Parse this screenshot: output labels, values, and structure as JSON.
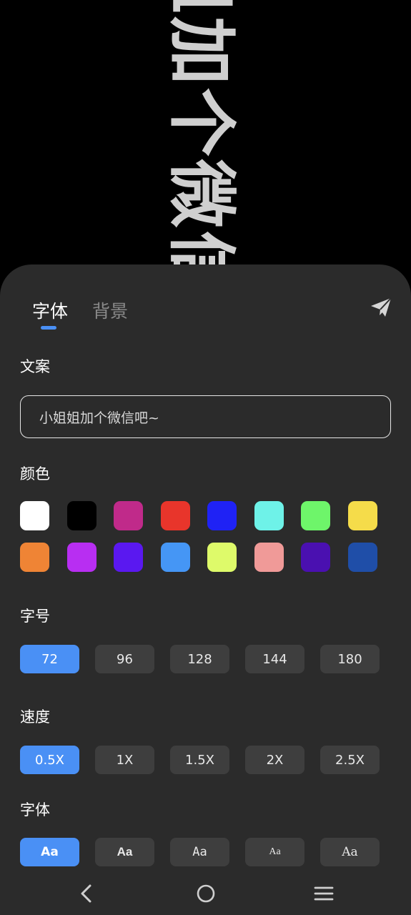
{
  "preview": {
    "marquee_text": "小姐姐加个微信吧~"
  },
  "tabs": [
    {
      "label": "字体",
      "active": true
    },
    {
      "label": "背景",
      "active": false
    }
  ],
  "send_icon": "send-icon",
  "sections": {
    "text": "文案",
    "color": "颜色",
    "size": "字号",
    "speed": "速度",
    "font": "字体"
  },
  "text_input": {
    "value": "小姐姐加个微信吧~"
  },
  "colors": [
    "#ffffff",
    "#000000",
    "#c02a8a",
    "#e8352b",
    "#1f22f5",
    "#6ef2e8",
    "#6ef56a",
    "#f5dc4a",
    "#ef8435",
    "#b82ef2",
    "#5a18f0",
    "#4596f5",
    "#defa6a",
    "#f09a98",
    "#4a10b0",
    "#1f4ea8"
  ],
  "sizes": [
    {
      "label": "72",
      "selected": true
    },
    {
      "label": "96",
      "selected": false
    },
    {
      "label": "128",
      "selected": false
    },
    {
      "label": "144",
      "selected": false
    },
    {
      "label": "180",
      "selected": false
    }
  ],
  "speeds": [
    {
      "label": "0.5X",
      "selected": true
    },
    {
      "label": "1X",
      "selected": false
    },
    {
      "label": "1.5X",
      "selected": false
    },
    {
      "label": "2X",
      "selected": false
    },
    {
      "label": "2.5X",
      "selected": false
    }
  ],
  "fonts": [
    {
      "label": "Aa",
      "selected": true
    },
    {
      "label": "Aa",
      "selected": false
    },
    {
      "label": "Aa",
      "selected": false
    },
    {
      "label": "Aa",
      "selected": false
    },
    {
      "label": "Aa",
      "selected": false
    }
  ],
  "accent_color": "#4a90f5",
  "navbar": {
    "back_icon": "back-icon",
    "home_icon": "home-icon",
    "menu_icon": "menu-icon"
  }
}
